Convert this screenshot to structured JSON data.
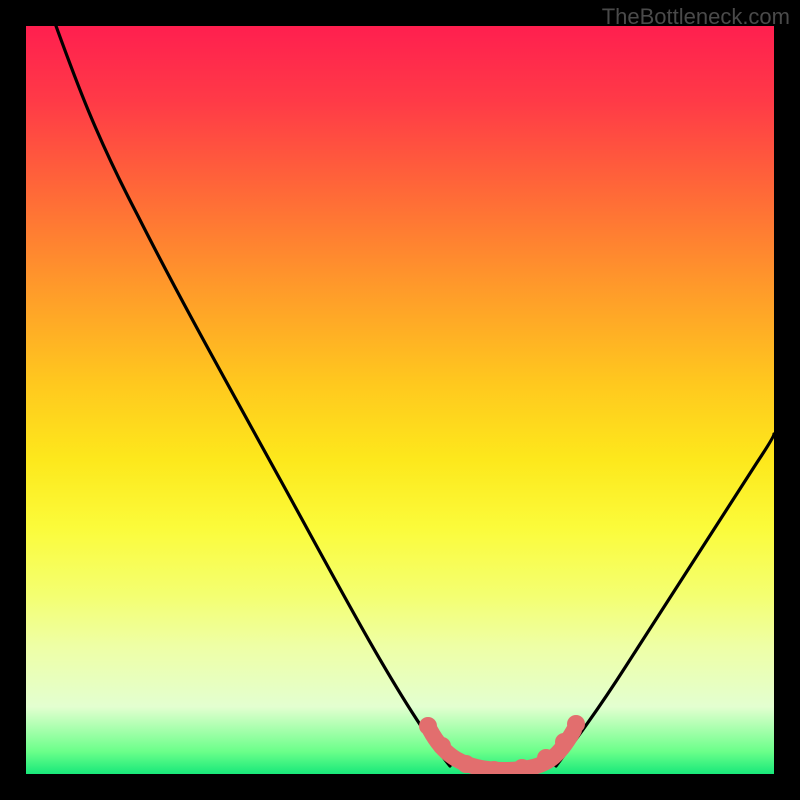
{
  "watermark": "TheBottleneck.com",
  "chart_data": {
    "type": "line",
    "title": "",
    "xlabel": "",
    "ylabel": "",
    "xlim": [
      0,
      100
    ],
    "ylim": [
      0,
      100
    ],
    "gradient_stops": [
      {
        "pos": 0,
        "color": "#ff1f4f"
      },
      {
        "pos": 10,
        "color": "#ff3a47"
      },
      {
        "pos": 22,
        "color": "#ff6838"
      },
      {
        "pos": 35,
        "color": "#ff9a2a"
      },
      {
        "pos": 48,
        "color": "#ffc91e"
      },
      {
        "pos": 58,
        "color": "#fde81c"
      },
      {
        "pos": 67,
        "color": "#fbfb3a"
      },
      {
        "pos": 76,
        "color": "#f4ff70"
      },
      {
        "pos": 83,
        "color": "#eeffa6"
      },
      {
        "pos": 91,
        "color": "#e3ffd0"
      },
      {
        "pos": 97,
        "color": "#6bff8a"
      },
      {
        "pos": 100,
        "color": "#18e87a"
      }
    ],
    "series": [
      {
        "name": "left-limb",
        "color": "#000000",
        "points": [
          {
            "x": 4,
            "y": 100
          },
          {
            "x": 8,
            "y": 91
          },
          {
            "x": 15,
            "y": 78
          },
          {
            "x": 23,
            "y": 64
          },
          {
            "x": 32,
            "y": 47
          },
          {
            "x": 40,
            "y": 32
          },
          {
            "x": 47,
            "y": 18
          },
          {
            "x": 52,
            "y": 8
          },
          {
            "x": 55,
            "y": 3
          }
        ]
      },
      {
        "name": "right-limb",
        "color": "#000000",
        "points": [
          {
            "x": 70,
            "y": 3
          },
          {
            "x": 74,
            "y": 8
          },
          {
            "x": 80,
            "y": 18
          },
          {
            "x": 88,
            "y": 32
          },
          {
            "x": 95,
            "y": 44
          },
          {
            "x": 100,
            "y": 52
          }
        ]
      },
      {
        "name": "valley-markers",
        "color": "#e26e6e",
        "points": [
          {
            "x": 54,
            "y": 5.5
          },
          {
            "x": 56,
            "y": 3.2
          },
          {
            "x": 58,
            "y": 2.0
          },
          {
            "x": 60,
            "y": 1.5
          },
          {
            "x": 62,
            "y": 1.4
          },
          {
            "x": 64,
            "y": 1.5
          },
          {
            "x": 66,
            "y": 2.0
          },
          {
            "x": 68,
            "y": 3.0
          },
          {
            "x": 70,
            "y": 4.5
          },
          {
            "x": 71,
            "y": 6.0
          }
        ]
      }
    ]
  }
}
